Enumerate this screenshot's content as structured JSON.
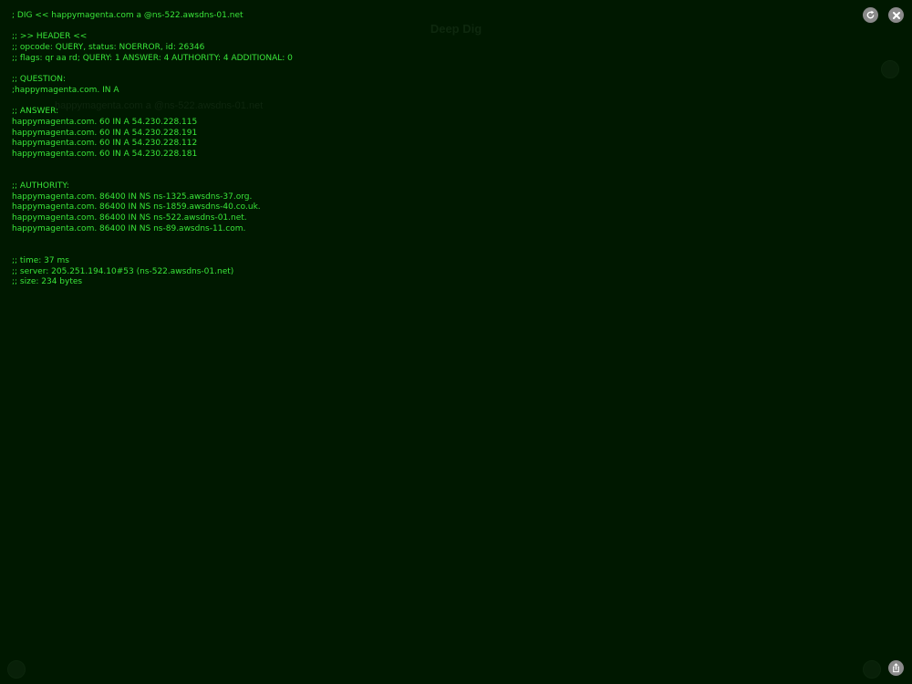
{
  "background_app": {
    "title": "Deep Dig",
    "query_echo": "happymagenta.com a @ns-522.awsdns-01.net"
  },
  "terminal": {
    "lines": [
      "; DIG << happymagenta.com a @ns-522.awsdns-01.net",
      "",
      ";; >> HEADER <<",
      ";; opcode: QUERY, status: NOERROR, id: 26346",
      ";; flags: qr aa rd; QUERY: 1 ANSWER: 4 AUTHORITY: 4 ADDITIONAL: 0",
      "",
      ";; QUESTION:",
      ";happymagenta.com. IN A",
      "",
      ";; ANSWER:",
      "happymagenta.com. 60 IN A 54.230.228.115",
      "happymagenta.com. 60 IN A 54.230.228.191",
      "happymagenta.com. 60 IN A 54.230.228.112",
      "happymagenta.com. 60 IN A 54.230.228.181",
      "",
      "",
      ";; AUTHORITY:",
      "happymagenta.com. 86400 IN NS ns-1325.awsdns-37.org.",
      "happymagenta.com. 86400 IN NS ns-1859.awsdns-40.co.uk.",
      "happymagenta.com. 86400 IN NS ns-522.awsdns-01.net.",
      "happymagenta.com. 86400 IN NS ns-89.awsdns-11.com.",
      "",
      "",
      ";; time: 37 ms",
      ";; server: 205.251.194.10#53 (ns-522.awsdns-01.net)",
      ";; size: 234 bytes"
    ]
  },
  "controls": {
    "refresh_icon": "refresh-icon",
    "close_icon": "close-icon",
    "share_icon": "share-icon"
  },
  "colors": {
    "background": "#001800",
    "terminal_text": "#39e439",
    "button": "#8a8a8a"
  }
}
